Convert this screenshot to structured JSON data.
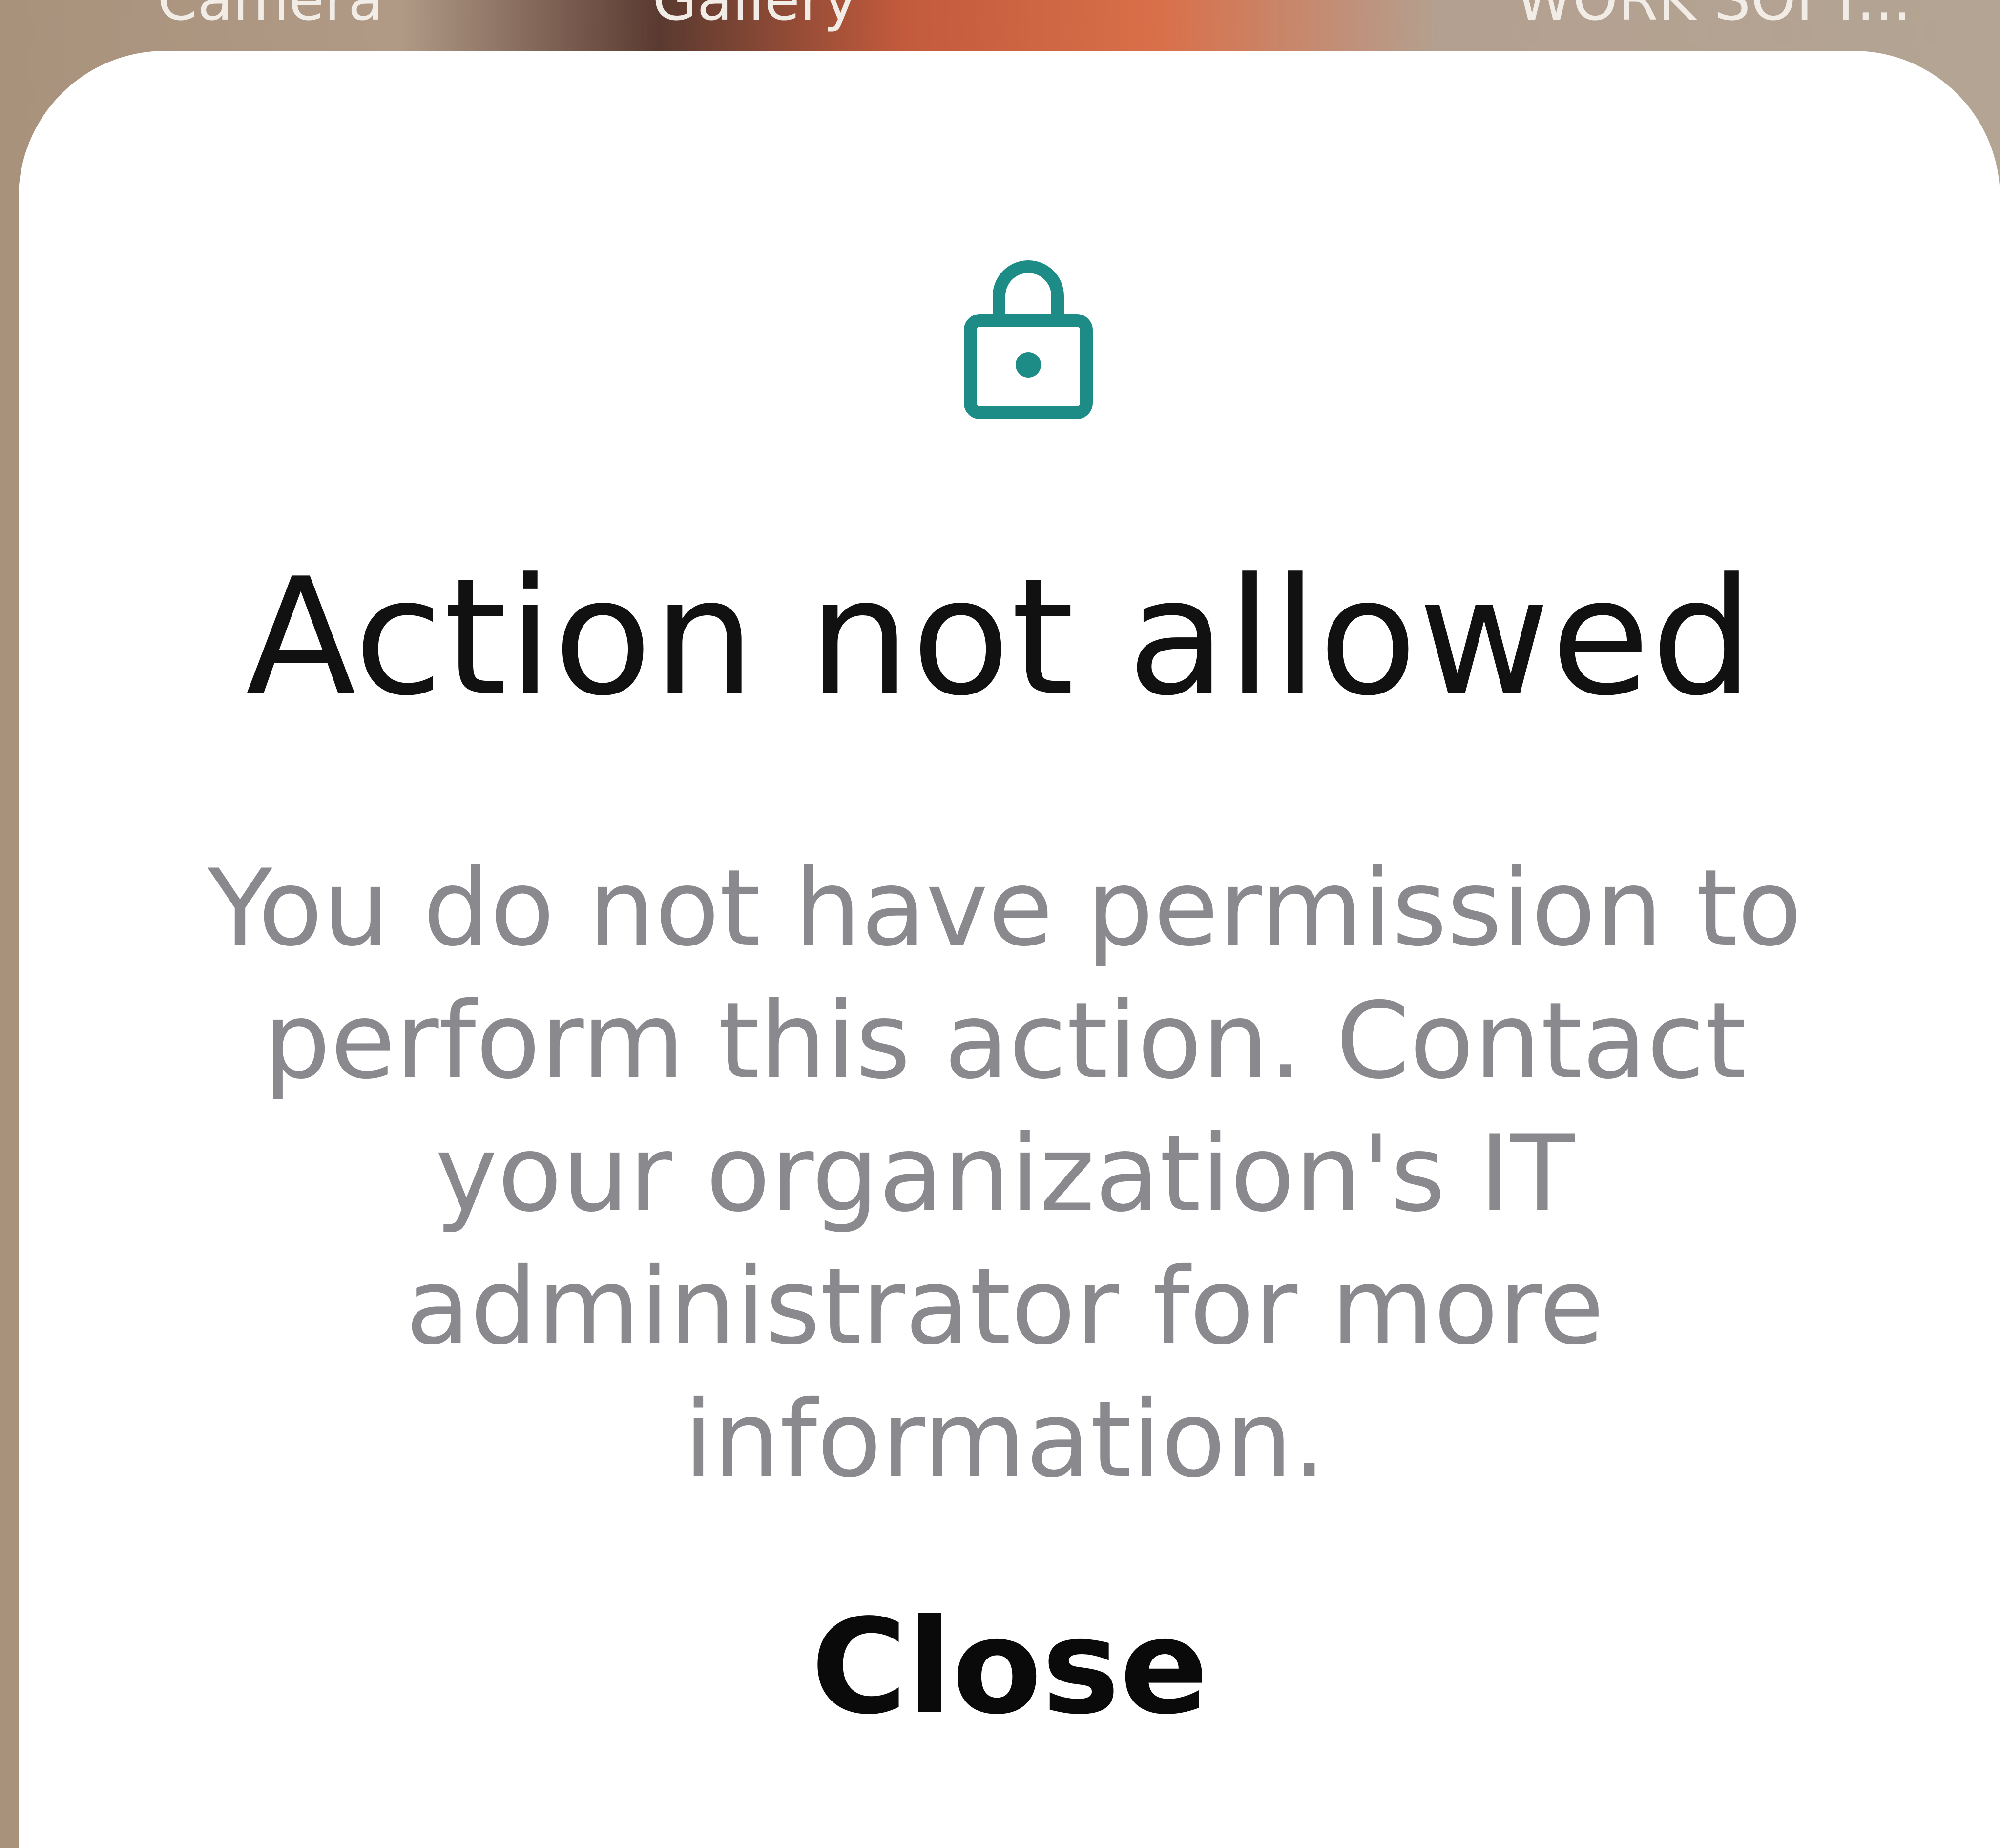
{
  "background_apps": {
    "camera_label": "Camera",
    "gallery_label": "Gallery",
    "work_label": "WORK SOFT..."
  },
  "dialog": {
    "icon": "lock-icon",
    "icon_color": "#1e8c86",
    "title": "Action not allowed",
    "message": "You do not have permission to perform this action. Contact your organization's IT administrator for more information.",
    "close_label": "Close"
  }
}
